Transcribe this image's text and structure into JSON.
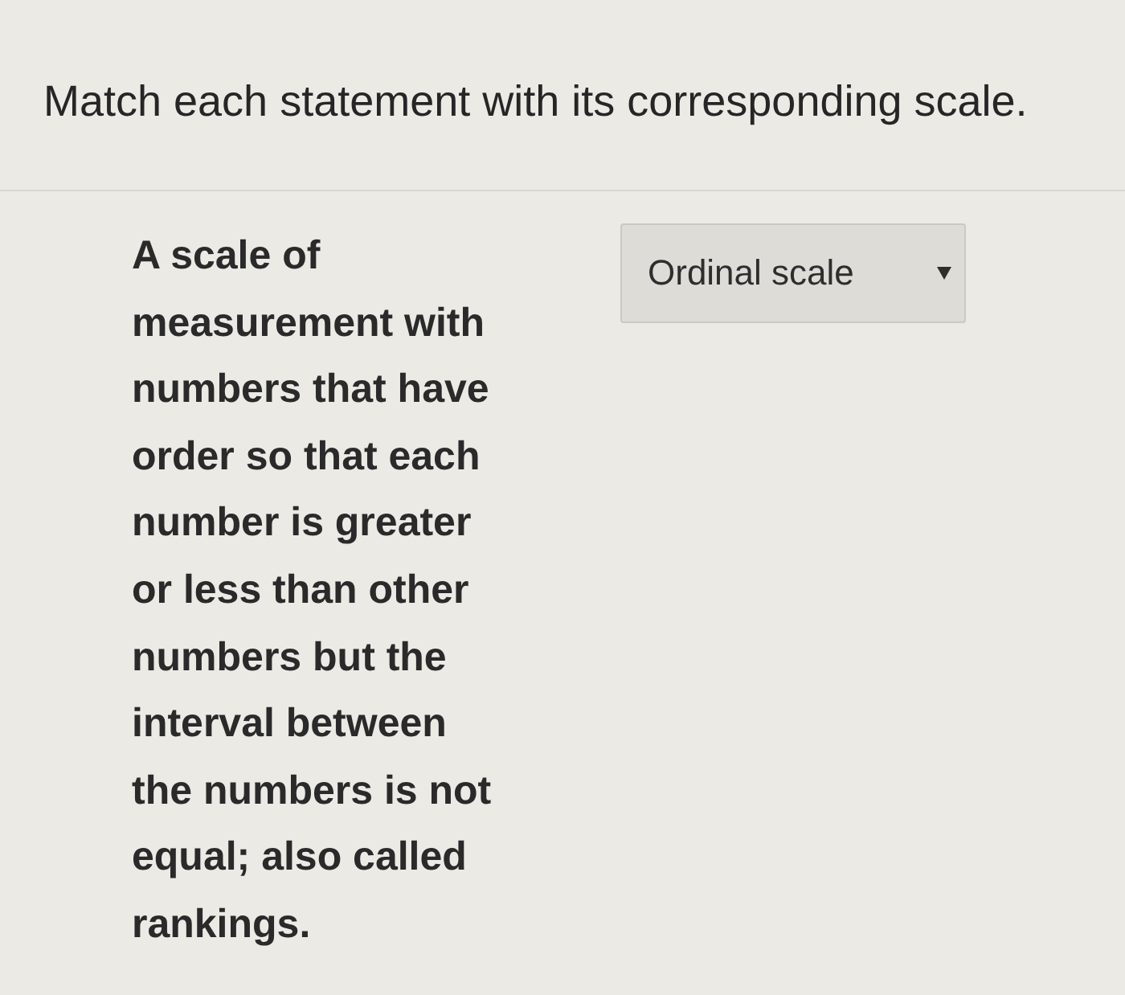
{
  "instruction": "Match each statement with its corresponding scale.",
  "items": [
    {
      "statement": "A scale of measurement with numbers that have order so that each number is greater or less than other numbers but the interval between the numbers is not equal; also called rankings.",
      "answer": {
        "value": "Ordinal scale"
      }
    }
  ]
}
